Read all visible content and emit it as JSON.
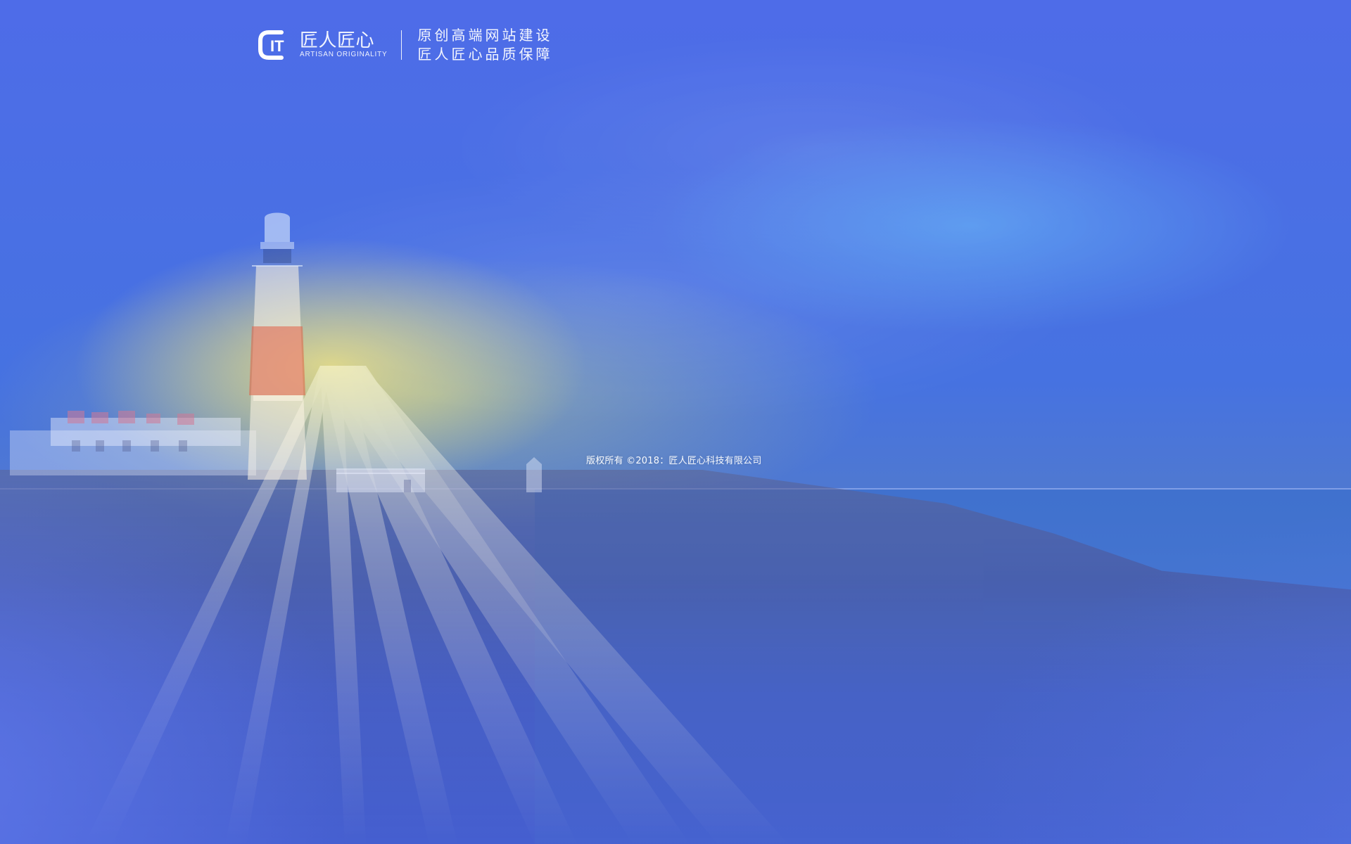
{
  "brand": {
    "logo_letters": "IT",
    "name_cn": "匠人匠心",
    "name_en": "ARTISAN ORIGINALITY",
    "tagline_lines": [
      "原创高端网站建设",
      "匠人匠心品质保障"
    ]
  },
  "footer": {
    "copyright": "版权所有 ©2018：匠人匠心科技有限公司"
  },
  "colors": {
    "overlay_blue": "#4169e1",
    "text_white": "#ffffff"
  },
  "icons": {
    "logo_mark": "brand-logo-icon"
  }
}
